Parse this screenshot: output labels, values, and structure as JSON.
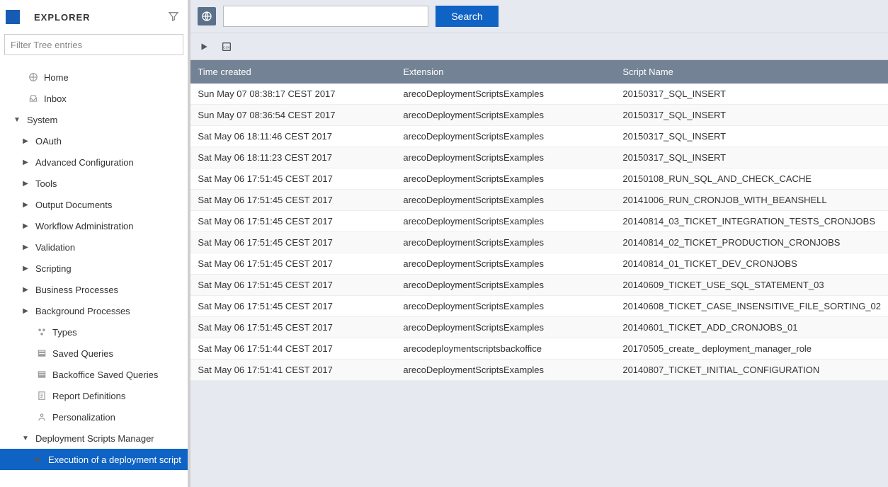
{
  "sidebar": {
    "title": "EXPLORER",
    "filter_placeholder": "Filter Tree entries",
    "items": [
      {
        "label": "Home",
        "icon": "home-icon",
        "type": "leaf"
      },
      {
        "label": "Inbox",
        "icon": "inbox-icon",
        "type": "leaf"
      },
      {
        "label": "System",
        "icon": "",
        "type": "expanded",
        "children": [
          {
            "label": "OAuth"
          },
          {
            "label": "Advanced Configuration"
          },
          {
            "label": "Tools"
          },
          {
            "label": "Output Documents"
          },
          {
            "label": "Workflow Administration"
          },
          {
            "label": "Validation"
          },
          {
            "label": "Scripting"
          },
          {
            "label": "Business Processes"
          },
          {
            "label": "Background Processes"
          },
          {
            "label": "Types",
            "icon": "types-icon"
          },
          {
            "label": "Saved Queries",
            "icon": "query-icon"
          },
          {
            "label": "Backoffice Saved Queries",
            "icon": "query-icon"
          },
          {
            "label": "Report Definitions",
            "icon": "report-icon"
          },
          {
            "label": "Personalization",
            "icon": "personalization-icon"
          },
          {
            "label": "Deployment Scripts Manager",
            "type": "expanded",
            "children": [
              {
                "label": "Execution of a deployment script",
                "selected": true
              }
            ]
          }
        ]
      }
    ]
  },
  "search": {
    "placeholder": "",
    "button_label": "Search"
  },
  "table": {
    "columns": [
      "Time created",
      "Extension",
      "Script Name"
    ],
    "rows": [
      [
        "Sun May 07 08:38:17 CEST 2017",
        "arecoDeploymentScriptsExamples",
        "20150317_SQL_INSERT"
      ],
      [
        "Sun May 07 08:36:54 CEST 2017",
        "arecoDeploymentScriptsExamples",
        "20150317_SQL_INSERT"
      ],
      [
        "Sat May 06 18:11:46 CEST 2017",
        "arecoDeploymentScriptsExamples",
        "20150317_SQL_INSERT"
      ],
      [
        "Sat May 06 18:11:23 CEST 2017",
        "arecoDeploymentScriptsExamples",
        "20150317_SQL_INSERT"
      ],
      [
        "Sat May 06 17:51:45 CEST 2017",
        "arecoDeploymentScriptsExamples",
        "20150108_RUN_SQL_AND_CHECK_CACHE"
      ],
      [
        "Sat May 06 17:51:45 CEST 2017",
        "arecoDeploymentScriptsExamples",
        "20141006_RUN_CRONJOB_WITH_BEANSHELL"
      ],
      [
        "Sat May 06 17:51:45 CEST 2017",
        "arecoDeploymentScriptsExamples",
        "20140814_03_TICKET_INTEGRATION_TESTS_CRONJOBS"
      ],
      [
        "Sat May 06 17:51:45 CEST 2017",
        "arecoDeploymentScriptsExamples",
        "20140814_02_TICKET_PRODUCTION_CRONJOBS"
      ],
      [
        "Sat May 06 17:51:45 CEST 2017",
        "arecoDeploymentScriptsExamples",
        "20140814_01_TICKET_DEV_CRONJOBS"
      ],
      [
        "Sat May 06 17:51:45 CEST 2017",
        "arecoDeploymentScriptsExamples",
        "20140609_TICKET_USE_SQL_STATEMENT_03"
      ],
      [
        "Sat May 06 17:51:45 CEST 2017",
        "arecoDeploymentScriptsExamples",
        "20140608_TICKET_CASE_INSENSITIVE_FILE_SORTING_02"
      ],
      [
        "Sat May 06 17:51:45 CEST 2017",
        "arecoDeploymentScriptsExamples",
        "20140601_TICKET_ADD_CRONJOBS_01"
      ],
      [
        "Sat May 06 17:51:44 CEST 2017",
        "arecodeploymentscriptsbackoffice",
        "20170505_create_ deployment_manager_role"
      ],
      [
        "Sat May 06 17:51:41 CEST 2017",
        "arecoDeploymentScriptsExamples",
        "20140807_TICKET_INITIAL_CONFIGURATION"
      ]
    ]
  }
}
